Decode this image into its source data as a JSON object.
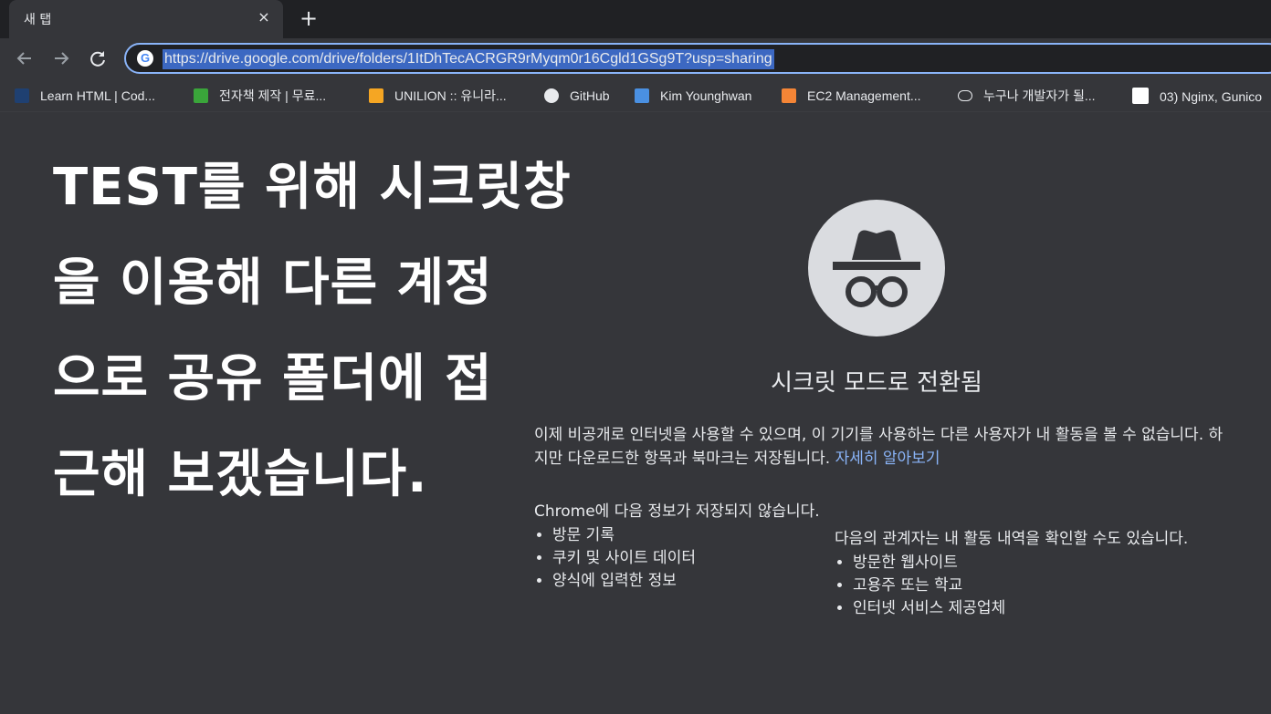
{
  "tab": {
    "title": "새 탭",
    "close": "×",
    "new_tab": "+"
  },
  "omnibox": {
    "url": "https://drive.google.com/drive/folders/1ItDhTecACRGR9rMyqm0r16Cgld1GSg9T?usp=sharing",
    "favicon": "G"
  },
  "bookmarks": [
    {
      "label": "Learn HTML | Cod...",
      "icon": "codecademy-icon",
      "color": "#1f4071"
    },
    {
      "label": "전자책 제작 | 무료...",
      "icon": "ebook-icon",
      "color": "#3aa53a"
    },
    {
      "label": "UNILION :: 유니라...",
      "icon": "unilion-icon",
      "color": "#f5a623"
    },
    {
      "label": "GitHub",
      "icon": "github-icon",
      "color": "#e8eaed"
    },
    {
      "label": "Kim Younghwan",
      "icon": "blog-icon",
      "color": "#4a90e2"
    },
    {
      "label": "EC2 Management...",
      "icon": "aws-icon",
      "color": "#f58536"
    },
    {
      "label": "누구나 개발자가 될...",
      "icon": "cloud-icon",
      "color": "#e8eaed"
    },
    {
      "label": "03) Nginx, Gunico",
      "icon": "wikidocs-icon",
      "color": "#ffffff"
    }
  ],
  "overlay": {
    "lines": [
      "TEST를 위해 시크릿창",
      "을 이용해 다른 계정",
      "으로 공유 폴더에 접",
      "근해 보겠습니다."
    ]
  },
  "incognito": {
    "title": "시크릿 모드로 전환됨",
    "description": "이제 비공개로 인터넷을 사용할 수 있으며, 이 기기를 사용하는 다른 사용자가 내 활동을 볼 수 없습니다. 하지만 다운로드한 항목과 북마크는 저장됩니다.",
    "learn_more": "자세히 알아보기",
    "not_saved_title": "Chrome에 다음 정보가 저장되지 않습니다.",
    "not_saved_items": [
      "방문 기록",
      "쿠키 및 사이트 데이터",
      "양식에 입력한 정보"
    ],
    "visible_title": "다음의 관계자는 내 활동 내역을 확인할 수도 있습니다.",
    "visible_items": [
      "방문한 웹사이트",
      "고용주 또는 학교",
      "인터넷 서비스 제공업체"
    ]
  },
  "colors": {
    "accent": "#8ab4f8",
    "background": "#35363a",
    "tabstrip": "#202124"
  }
}
